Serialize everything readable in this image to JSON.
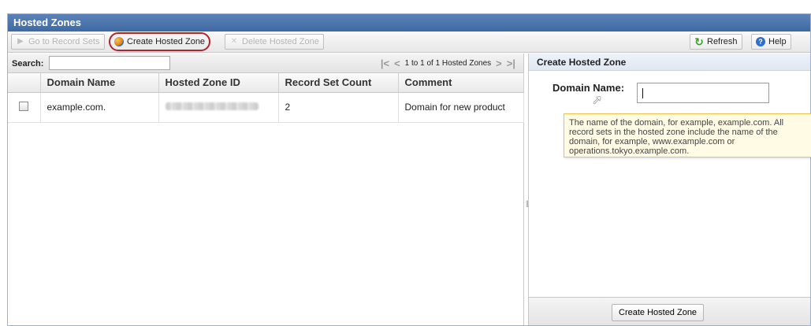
{
  "window": {
    "title": "Hosted Zones"
  },
  "toolbar": {
    "go_to_record_sets": "Go to Record Sets",
    "create_hosted_zone": "Create Hosted Zone",
    "delete_hosted_zone": "Delete Hosted Zone",
    "refresh": "Refresh",
    "help": "Help"
  },
  "search": {
    "label": "Search:",
    "value": ""
  },
  "pager": {
    "text": "1 to 1 of 1 Hosted Zones"
  },
  "table": {
    "columns": [
      "Domain Name",
      "Hosted Zone ID",
      "Record Set Count",
      "Comment"
    ],
    "rows": [
      {
        "domain": "example.com.",
        "zone_id": "",
        "record_count": "2",
        "comment": "Domain for new product"
      }
    ]
  },
  "panel": {
    "title": "Create Hosted Zone",
    "domain_label": "Domain Name:",
    "domain_value": "",
    "tooltip": "The name of the domain, for example, example.com. All record sets in the hosted zone include the name of the domain, for example, www.example.com or operations.tokyo.example.com.",
    "submit": "Create Hosted Zone"
  },
  "colors": {
    "accent": "#3e69a3",
    "highlight_ring": "#b3232d",
    "tooltip_bg": "#fffbe5"
  },
  "icons": [
    "arrow-right-icon",
    "globe-icon",
    "delete-x-icon",
    "refresh-icon",
    "help-icon",
    "first-page-icon",
    "prev-page-icon",
    "next-page-icon",
    "last-page-icon",
    "checkbox-icon",
    "mouse-cursor-icon"
  ]
}
